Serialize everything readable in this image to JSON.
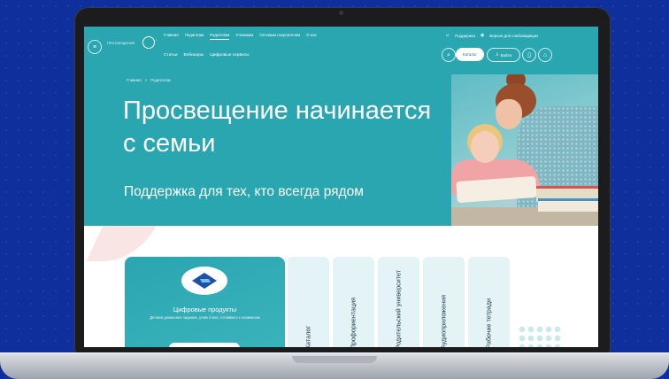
{
  "header": {
    "logo_text": "ПРОСВЕЩЕНИЕ",
    "top_nav": [
      {
        "label": "Главная",
        "active": false
      },
      {
        "label": "Педагогам",
        "active": false
      },
      {
        "label": "Родителям",
        "active": true
      },
      {
        "label": "Ученикам",
        "active": false
      },
      {
        "label": "Оптовым покупателям",
        "active": false
      },
      {
        "label": "О нас",
        "active": false
      }
    ],
    "sub_nav": [
      "Статьи",
      "Вебинары",
      "Цифровые сервисы"
    ],
    "support_label": "Поддержка",
    "accessibility_label": "Версия для слабовидящих",
    "catalog_button": "Каталог",
    "login_button": "Войти"
  },
  "hero": {
    "breadcrumb": [
      "Главная",
      ">",
      "Родителям"
    ],
    "title": "Просвещение начинается с семьи",
    "subtitle": "Поддержка для тех, кто всегда рядом"
  },
  "digital_card": {
    "title": "Цифровые продукты",
    "description": "Делаем домашнее задание, учим стихи, готовимся к экзаменам"
  },
  "tabs": [
    "Каталог",
    "Профориентация",
    "Родительский университет",
    "Аудиоприложения",
    "Рабочие тетради"
  ],
  "colors": {
    "accent": "#2aa6b0",
    "background": "#0f2f9c",
    "tab_bg": "#e4f3f6"
  }
}
